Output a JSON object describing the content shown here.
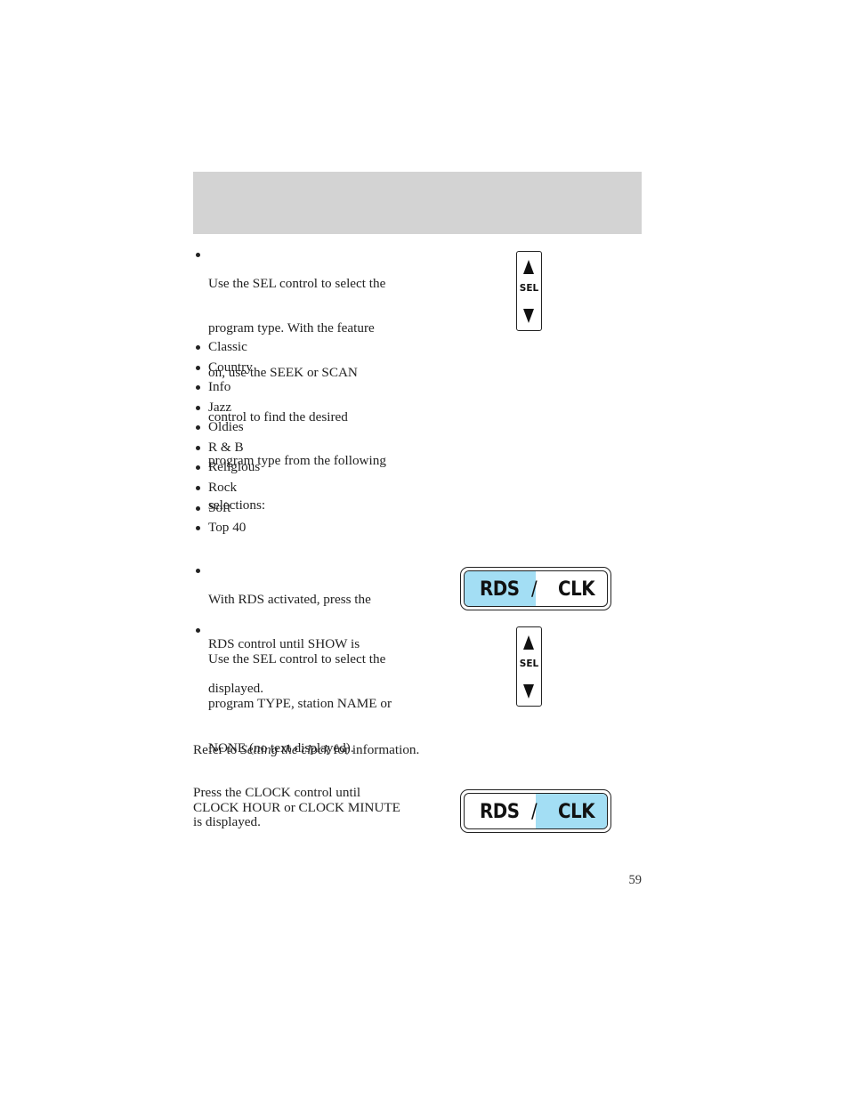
{
  "page": {
    "page_number": "59"
  },
  "program_type": {
    "intro_bullet": [
      "Use the SEL control to select the",
      "program type. With the feature",
      "on, use the SEEK or SCAN",
      "control to find the desired",
      "program type from the following",
      "selections:"
    ],
    "selections": [
      "Classic",
      "Country",
      "Info",
      "Jazz",
      "Oldies",
      "R & B",
      "Religious",
      "Rock",
      "Soft",
      "Top 40"
    ]
  },
  "show_section": {
    "bullet1": [
      "With RDS activated, press the",
      "RDS control until SHOW is",
      "displayed."
    ],
    "bullet2": [
      "Use the SEL control to select the",
      "program TYPE, station NAME or",
      "NONE (no text displayed)."
    ]
  },
  "clock_section": {
    "refer_prefix": "Refer to ",
    "refer_link": "Setting the clock",
    "refer_suffix": " for information.",
    "press": [
      "Press the CLOCK control until",
      "CLOCK HOUR or CLOCK MINUTE",
      "is displayed."
    ]
  },
  "controls": {
    "sel_label": "SEL",
    "rds_label": "RDS",
    "slash": "/",
    "clk_label": "CLK",
    "highlight_color": "#a3def4"
  }
}
